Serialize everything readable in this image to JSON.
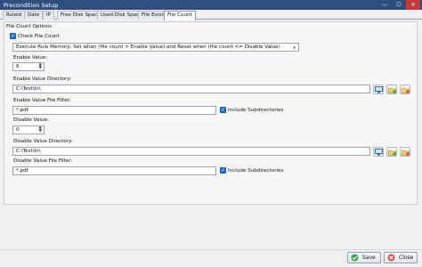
{
  "window": {
    "title": "Precondition Setup",
    "min": "—",
    "max": "☐",
    "close": "✕"
  },
  "tabs": [
    {
      "label": "RuleId"
    },
    {
      "label": "Date"
    },
    {
      "label": "IP"
    },
    {
      "label": "Free Disk Space"
    },
    {
      "label": "Used Disk Space"
    },
    {
      "label": "File Exists"
    },
    {
      "label": "File Count"
    }
  ],
  "group": {
    "title": "File Count Options"
  },
  "check_file_count": {
    "label": "Check File Count",
    "checked": true
  },
  "rule_dropdown": {
    "value": "Execute Rule Memory, Set when (file count > Enable Value) and Reset when (file count <= Disable Value)"
  },
  "enable": {
    "value_label": "Enable Value:",
    "value": "6",
    "dir_label": "Enable Value Directory:",
    "dir": "C:\\Test\\In\\",
    "filter_label": "Enable Value File Filter:",
    "filter": "*.pdf",
    "include_sub": "Include Subdirectories"
  },
  "disable": {
    "value_label": "Disable Value:",
    "value": "0",
    "dir_label": "Disable Value Directory:",
    "dir": "C:\\Test\\In\\",
    "filter_label": "Disable Value File Filter:",
    "filter": "*.pdf",
    "include_sub": "Include Subdirectories"
  },
  "footer": {
    "save": "Save",
    "close": "Close"
  },
  "colors": {
    "titlebar": "#2e4f7d",
    "accent": "#1f6fd6",
    "close": "#c03a3a"
  }
}
